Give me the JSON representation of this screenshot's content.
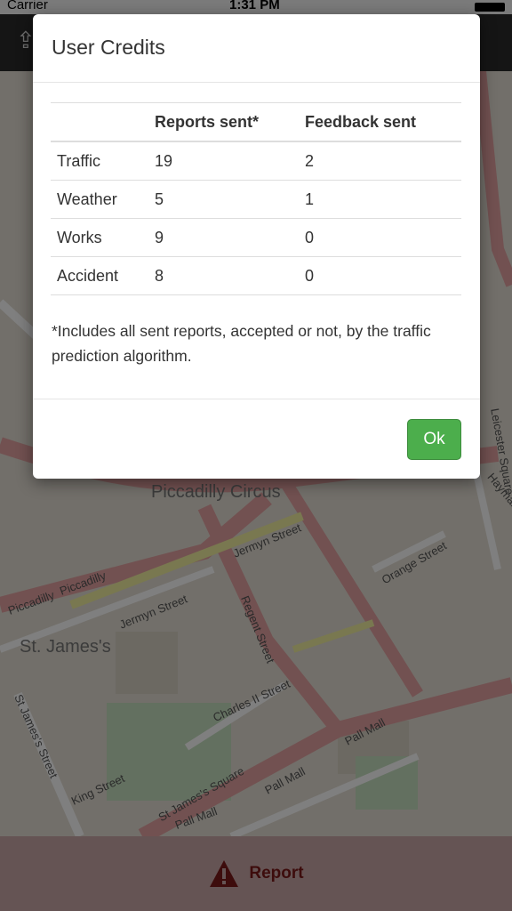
{
  "status_bar": {
    "carrier": "Carrier",
    "time": "1:31 PM"
  },
  "map": {
    "labels": [
      "Piccadilly Circus",
      "St. James's",
      "Piccadilly",
      "Piccadilly",
      "Jermyn Street",
      "Jermyn Street",
      "Regent Street",
      "Orange Street",
      "Charles II Street",
      "Pall Mall",
      "Pall Mall",
      "Pall Mall",
      "King Street",
      "St James's Square",
      "St James's Street",
      "Leicester Square",
      "Haymarket"
    ]
  },
  "bottom_bar": {
    "report_label": "Report"
  },
  "modal": {
    "title": "User Credits",
    "table": {
      "headers": [
        "",
        "Reports sent*",
        "Feedback sent"
      ],
      "rows": [
        {
          "category": "Traffic",
          "reports": "19",
          "feedback": "2"
        },
        {
          "category": "Weather",
          "reports": "5",
          "feedback": "1"
        },
        {
          "category": "Works",
          "reports": "9",
          "feedback": "0"
        },
        {
          "category": "Accident",
          "reports": "8",
          "feedback": "0"
        }
      ]
    },
    "note": "*Includes all sent reports, accepted or not, by the traffic prediction algorithm.",
    "ok_label": "Ok"
  },
  "colors": {
    "ok_button": "#4cae4c",
    "report_text": "#7a1818",
    "road": "#e8a0a0"
  },
  "icons": {
    "nav": "share-icon",
    "report": "warning-triangle-icon"
  }
}
